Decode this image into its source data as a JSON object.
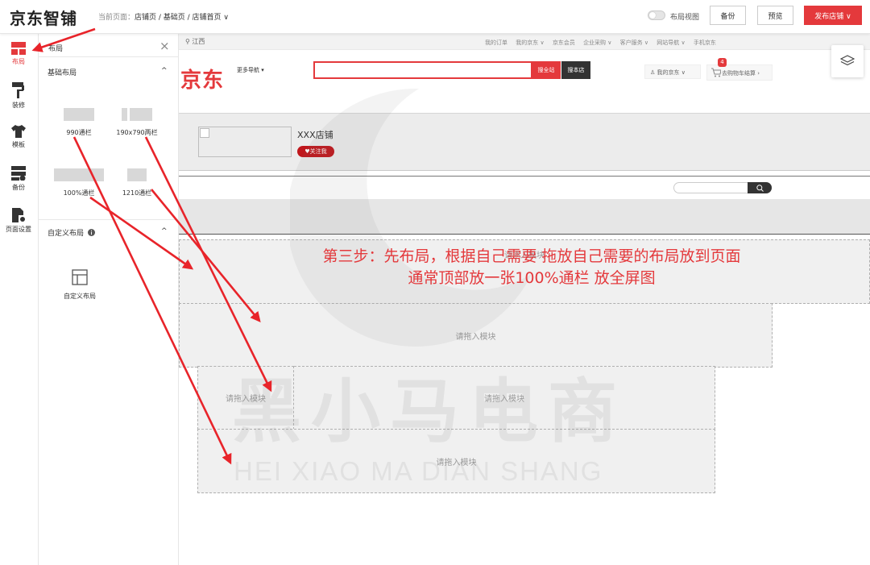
{
  "header": {
    "logo": "京东智铺",
    "breadcrumb_prefix": "当前页面：",
    "breadcrumb": "店铺页 / 基础页 / 店铺首页 ∨",
    "layout_view_label": "布局视图",
    "backup_label": "备份",
    "preview_label": "预览",
    "publish_label": "发布店铺 ∨"
  },
  "rail": {
    "items": [
      {
        "label": "布局",
        "icon": "layout-icon"
      },
      {
        "label": "装修",
        "icon": "paint-roller-icon"
      },
      {
        "label": "模板",
        "icon": "tshirt-icon"
      },
      {
        "label": "备份",
        "icon": "backup-icon"
      },
      {
        "label": "页面设置",
        "icon": "page-settings-icon"
      }
    ]
  },
  "panel": {
    "title": "布局",
    "close": "×",
    "basic_title": "基础布局",
    "basic_items": [
      "990通栏",
      "190x790两栏",
      "100%通栏",
      "1210通栏"
    ],
    "custom_title": "自定义布局",
    "custom_item": "自定义布局",
    "chevron": "^"
  },
  "canvas": {
    "location": "江西",
    "top_links": [
      "我的订单",
      "我的京东 ∨",
      "京东会员",
      "企业采购 ∨",
      "客户服务 ∨",
      "网站导航 ∨",
      "手机京东"
    ],
    "logo": "京东",
    "more_nav": "更多导航 ▾",
    "search_all": "搜全站",
    "search_shop": "搜本店",
    "my_jd": "我的京东 ∨",
    "cart": "去购物车结算 ›",
    "cart_count": "4",
    "shop_name": "XXX店铺",
    "follow": "关注我",
    "drop_hint": "请拖入模块"
  },
  "annotation": {
    "line1": "第三步：先布局，根据自己需要 拖放自己需要的布局放到页面",
    "line2": "通常顶部放一张100%通栏  放全屏图"
  },
  "watermark": {
    "title": "黑小马电商",
    "subtitle": "HEI XIAO MA DIAN SHANG"
  },
  "colors": {
    "accent": "#e4393c",
    "dark_red": "#c0171c"
  }
}
